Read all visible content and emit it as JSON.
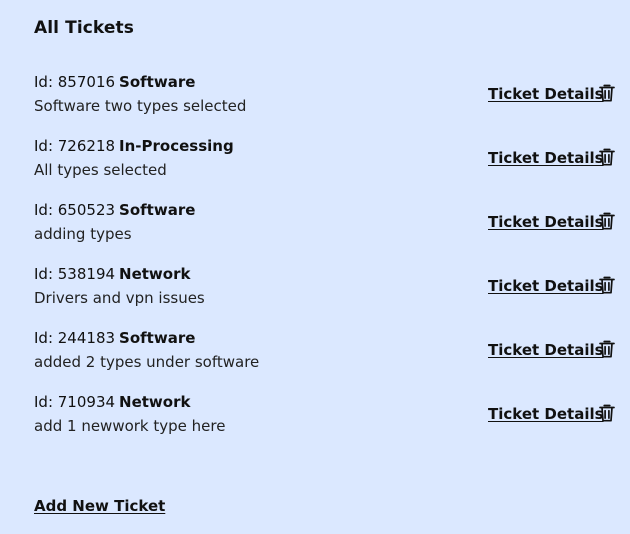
{
  "header": {
    "title": "All Tickets"
  },
  "tickets": [
    {
      "id_label": "Id: 857016",
      "type": "Software",
      "description": "Software two types selected",
      "details_label": "Ticket Details"
    },
    {
      "id_label": "Id: 726218",
      "type": "In-Processing",
      "description": "All types selected",
      "details_label": "Ticket Details"
    },
    {
      "id_label": "Id: 650523",
      "type": "Software",
      "description": "adding types",
      "details_label": "Ticket Details"
    },
    {
      "id_label": "Id: 538194",
      "type": "Network",
      "description": "Drivers and vpn issues",
      "details_label": "Ticket Details"
    },
    {
      "id_label": "Id: 244183",
      "type": "Software",
      "description": "added 2 types under software",
      "details_label": "Ticket Details"
    },
    {
      "id_label": "Id: 710934",
      "type": "Network",
      "description": "add 1 newwork type here",
      "details_label": "Ticket Details"
    }
  ],
  "footer": {
    "add_label": "Add New Ticket"
  },
  "icons": {
    "delete": "trash-icon"
  },
  "colors": {
    "background": "#dbe8ff",
    "text": "#111111"
  }
}
